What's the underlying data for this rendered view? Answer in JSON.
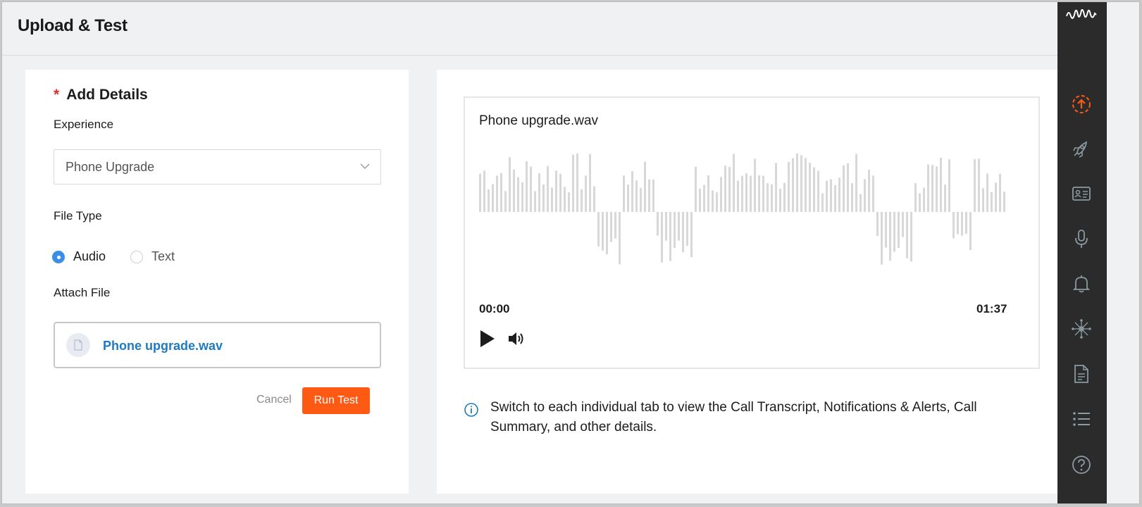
{
  "header": {
    "title": "Upload & Test"
  },
  "form": {
    "required_mark": "*",
    "section_title": "Add Details",
    "experience_label": "Experience",
    "experience_value": "Phone Upgrade",
    "file_type_label": "File Type",
    "file_type_options": [
      "Audio",
      "Text"
    ],
    "file_type_selected": "Audio",
    "attach_label": "Attach File",
    "attached_file": "Phone upgrade.wav",
    "cancel_label": "Cancel",
    "run_label": "Run Test"
  },
  "player": {
    "file_name": "Phone upgrade.wav",
    "current_time": "00:00",
    "duration": "01:37"
  },
  "info": {
    "text": "Switch to each individual tab to view the Call Transcript, Notifications & Alerts, Call Summary, and other details."
  },
  "sidebar": {
    "logo": "waveform-logo",
    "items": [
      {
        "icon": "upload-icon",
        "active": true
      },
      {
        "icon": "rocket-icon",
        "active": false
      },
      {
        "icon": "id-card-icon",
        "active": false
      },
      {
        "icon": "microphone-icon",
        "active": false
      },
      {
        "icon": "bell-icon",
        "active": false
      },
      {
        "icon": "network-icon",
        "active": false
      },
      {
        "icon": "document-icon",
        "active": false
      },
      {
        "icon": "list-icon",
        "active": false
      },
      {
        "icon": "help-icon",
        "active": false
      }
    ]
  },
  "colors": {
    "accent": "#ff5a14",
    "link": "#1f7bc1",
    "radio": "#3a8ee6",
    "sidebar_bg": "#2b2b2b",
    "sidebar_icon": "#8a9aa3",
    "required": "#e0302a",
    "waveform": "#d8d8d8"
  }
}
